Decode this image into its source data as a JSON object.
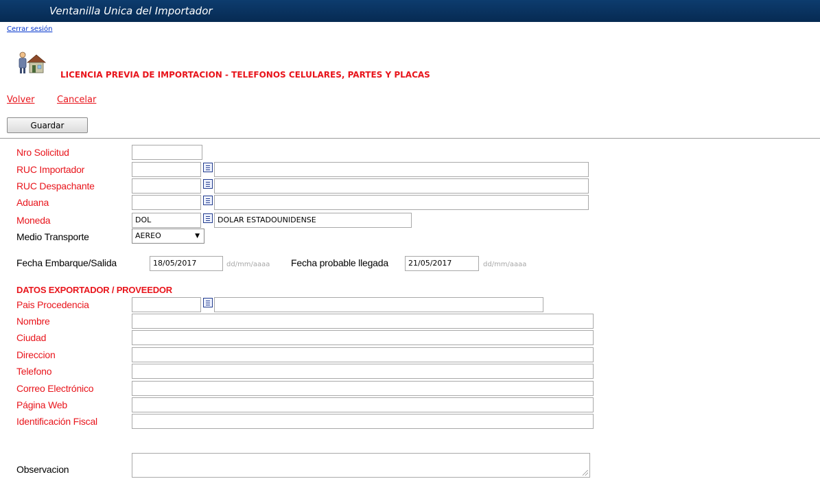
{
  "app_title": "Ventanilla Unica del Importador",
  "logout_label": "Cerrar sesión",
  "page_title": "LICENCIA PREVIA DE IMPORTACION - TELEFONOS CELULARES, PARTES Y PLACAS",
  "nav": {
    "back": "Volver",
    "cancel": "Cancelar"
  },
  "save_label": "Guardar",
  "form": {
    "nro_solicitud": {
      "label": "Nro Solicitud",
      "value": ""
    },
    "ruc_importador": {
      "label": "RUC Importador",
      "code": "",
      "desc": ""
    },
    "ruc_despachante": {
      "label": "RUC Despachante",
      "code": "",
      "desc": ""
    },
    "aduana": {
      "label": "Aduana",
      "code": "",
      "desc": ""
    },
    "moneda": {
      "label": "Moneda",
      "code": "DOL",
      "desc": "DOLAR ESTADOUNIDENSE"
    },
    "medio_transporte": {
      "label": "Medio Transporte",
      "value": "AEREO"
    },
    "fecha_embarque": {
      "label": "Fecha Embarque/Salida",
      "value": "18/05/2017",
      "hint": "dd/mm/aaaa"
    },
    "fecha_llegada": {
      "label": "Fecha probable llegada",
      "value": "21/05/2017",
      "hint": "dd/mm/aaaa"
    }
  },
  "exporter": {
    "section_title": "DATOS EXPORTADOR / PROVEEDOR",
    "pais": {
      "label": "Pais Procedencia",
      "code": "",
      "desc": ""
    },
    "nombre": {
      "label": "Nombre",
      "value": ""
    },
    "ciudad": {
      "label": "Ciudad",
      "value": ""
    },
    "direccion": {
      "label": "Direccion",
      "value": ""
    },
    "telefono": {
      "label": "Telefono",
      "value": ""
    },
    "correo": {
      "label": "Correo Electrónico",
      "value": ""
    },
    "web": {
      "label": "Página Web",
      "value": ""
    },
    "fiscal": {
      "label": "Identificación Fiscal",
      "value": ""
    }
  },
  "observacion": {
    "label": "Observacion",
    "value": ""
  },
  "colors": {
    "header_bg": "#0a3564",
    "label_red": "#e8141b",
    "link_blue": "#0033cc"
  },
  "icons": {
    "page_icon": "user-house-icon",
    "lookup_icon": "list-lookup-icon",
    "dropdown_icon": "triangle-down-icon"
  }
}
